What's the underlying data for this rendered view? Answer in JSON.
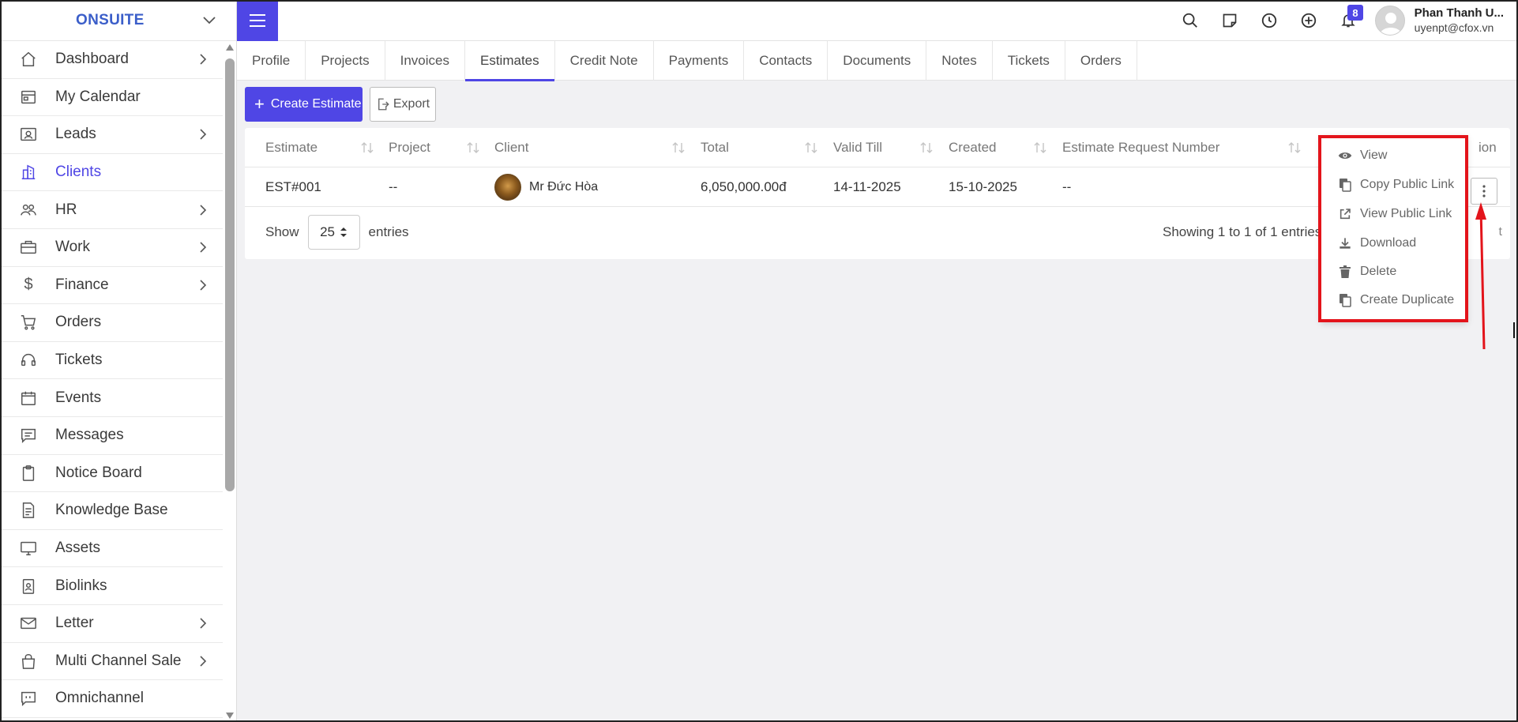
{
  "brand": {
    "name": "ONSUITE"
  },
  "sidebar": {
    "items": [
      {
        "label": "Dashboard",
        "icon": "home-icon",
        "has_children": true
      },
      {
        "label": "My Calendar",
        "icon": "calendar-icon",
        "has_children": false
      },
      {
        "label": "Leads",
        "icon": "contact-card-icon",
        "has_children": true
      },
      {
        "label": "Clients",
        "icon": "building-icon",
        "has_children": false,
        "active": true
      },
      {
        "label": "HR",
        "icon": "people-icon",
        "has_children": true
      },
      {
        "label": "Work",
        "icon": "briefcase-icon",
        "has_children": true
      },
      {
        "label": "Finance",
        "icon": "dollar-icon",
        "has_children": true
      },
      {
        "label": "Orders",
        "icon": "cart-icon",
        "has_children": false
      },
      {
        "label": "Tickets",
        "icon": "headset-icon",
        "has_children": false
      },
      {
        "label": "Events",
        "icon": "event-calendar-icon",
        "has_children": false
      },
      {
        "label": "Messages",
        "icon": "message-icon",
        "has_children": false
      },
      {
        "label": "Notice Board",
        "icon": "clipboard-icon",
        "has_children": false
      },
      {
        "label": "Knowledge Base",
        "icon": "document-icon",
        "has_children": false
      },
      {
        "label": "Assets",
        "icon": "monitor-icon",
        "has_children": false
      },
      {
        "label": "Biolinks",
        "icon": "id-badge-icon",
        "has_children": false
      },
      {
        "label": "Letter",
        "icon": "envelope-icon",
        "has_children": true
      },
      {
        "label": "Multi Channel Sale",
        "icon": "bag-icon",
        "has_children": true
      },
      {
        "label": "Omnichannel",
        "icon": "chat-quote-icon",
        "has_children": false
      }
    ]
  },
  "topbar": {
    "notification_count": "8",
    "user_name": "Phan Thanh U...",
    "user_email": "uyenpt@cfox.vn"
  },
  "tabs": [
    {
      "label": "Profile"
    },
    {
      "label": "Projects"
    },
    {
      "label": "Invoices"
    },
    {
      "label": "Estimates",
      "active": true
    },
    {
      "label": "Credit Note"
    },
    {
      "label": "Payments"
    },
    {
      "label": "Contacts"
    },
    {
      "label": "Documents"
    },
    {
      "label": "Notes"
    },
    {
      "label": "Tickets"
    },
    {
      "label": "Orders"
    }
  ],
  "actions": {
    "create_label": "Create Estimate",
    "export_label": "Export"
  },
  "table": {
    "headers": [
      "Estimate",
      "Project",
      "Client",
      "Total",
      "Valid Till",
      "Created",
      "Estimate Request Number",
      "ion"
    ],
    "rows": [
      {
        "estimate": "EST#001",
        "project": "--",
        "client": "Mr Đức Hòa",
        "total": "6,050,000.00đ",
        "valid_till": "14-11-2025",
        "created": "15-10-2025",
        "request_number": "--"
      }
    ],
    "show_label": "Show",
    "page_size": "25",
    "entries_label": "entries",
    "showing_text": "Showing 1 to 1 of 1 entries",
    "pager_partial": "t"
  },
  "dropdown": {
    "items": [
      {
        "label": "View",
        "icon": "eye-icon"
      },
      {
        "label": "Copy Public Link",
        "icon": "copy-icon"
      },
      {
        "label": "View Public Link",
        "icon": "external-link-icon"
      },
      {
        "label": "Download",
        "icon": "download-icon"
      },
      {
        "label": "Delete",
        "icon": "trash-icon"
      },
      {
        "label": "Create Duplicate",
        "icon": "duplicate-icon"
      }
    ]
  },
  "colors": {
    "accent": "#4f46e5",
    "brand_text": "#3b5ec9",
    "highlight": "#e3141b"
  }
}
